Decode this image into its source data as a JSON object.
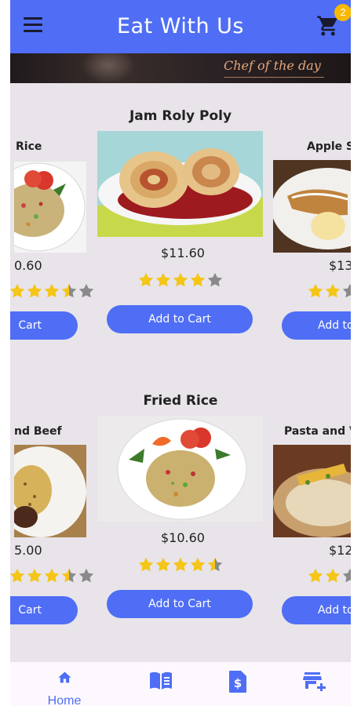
{
  "appbar": {
    "title": "Eat With Us",
    "cart_count": "2",
    "accent_color": "#4f6ef5",
    "badge_color": "#f7b800"
  },
  "banner": {
    "text": "Chef of the day"
  },
  "sections": [
    {
      "title": "Jam Roly Poly",
      "left_item": {
        "name": "Rice",
        "price": "0.60",
        "button": "Cart",
        "rating": 3.5
      },
      "center_item": {
        "price": "$11.60",
        "button": "Add to Cart",
        "rating": 4
      },
      "right_item": {
        "name": "Apple S",
        "price": "$13",
        "button": "Add to",
        "rating": 2
      }
    },
    {
      "title": "Fried Rice",
      "left_item": {
        "name": "nd Beef",
        "price": "5.00",
        "button": "Cart",
        "rating": 3.5
      },
      "center_item": {
        "price": "$10.60",
        "button": "Add to Cart",
        "rating": 4.5
      },
      "right_item": {
        "name": "Pasta and V",
        "price": "$12",
        "button": "Add to",
        "rating": 2
      }
    }
  ],
  "bottom_nav": {
    "items": [
      {
        "label": "Home",
        "icon": "home-icon",
        "active": true
      },
      {
        "label": "",
        "icon": "menu-book-icon",
        "active": false
      },
      {
        "label": "",
        "icon": "receipt-dollar-icon",
        "active": false
      },
      {
        "label": "",
        "icon": "add-store-icon",
        "active": false
      }
    ]
  }
}
